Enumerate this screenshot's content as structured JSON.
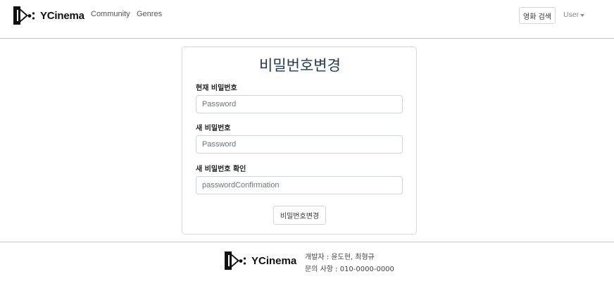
{
  "navbar": {
    "brand": "YCinema",
    "links": [
      "Community",
      "Genres"
    ],
    "search_button": "영화 검색",
    "user_menu": "User"
  },
  "form": {
    "title": "비밀번호변경",
    "current_password": {
      "label": "현재 비밀번호",
      "placeholder": "Password"
    },
    "new_password": {
      "label": "새 비밀번호",
      "placeholder": "Password"
    },
    "confirm_password": {
      "label": "새 비밀번호 확인",
      "placeholder": "passwordConfirmation"
    },
    "submit_label": "비밀번호변경"
  },
  "footer": {
    "brand": "YCinema",
    "developers": "개발자 : 윤도현, 최형규",
    "contact": "문의 사항 : 010-0000-0000"
  },
  "icons": {
    "logo": "ycinema-logo-icon",
    "dropdown": "caret-down-icon"
  },
  "colors": {
    "title": "#253a52",
    "border": "#d9d9d9"
  }
}
